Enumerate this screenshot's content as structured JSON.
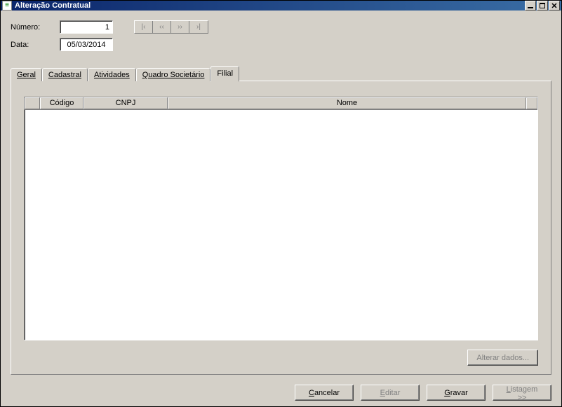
{
  "window": {
    "title": "Alteração Contratual"
  },
  "form": {
    "numero_label": "Número:",
    "numero_value": "1",
    "data_label": "Data:",
    "data_value": "05/03/2014"
  },
  "nav": {
    "first": "|‹",
    "prev": "‹‹",
    "next": "››",
    "last": "›|"
  },
  "tabs": {
    "geral": "Geral",
    "cadastral": "Cadastral",
    "atividades": "Atividades",
    "quadro": "Quadro Societário",
    "filial": "Filial"
  },
  "grid": {
    "columns": {
      "codigo": "Código",
      "cnpj": "CNPJ",
      "nome": "Nome"
    },
    "rows": []
  },
  "buttons": {
    "alterar_dados": "Alterar dados...",
    "cancelar_prefix": "C",
    "cancelar_rest": "ancelar",
    "editar_prefix": "E",
    "editar_rest": "ditar",
    "gravar_prefix": "G",
    "gravar_rest": "ravar",
    "listagem_prefix": "L",
    "listagem_rest": "istagem >>"
  }
}
